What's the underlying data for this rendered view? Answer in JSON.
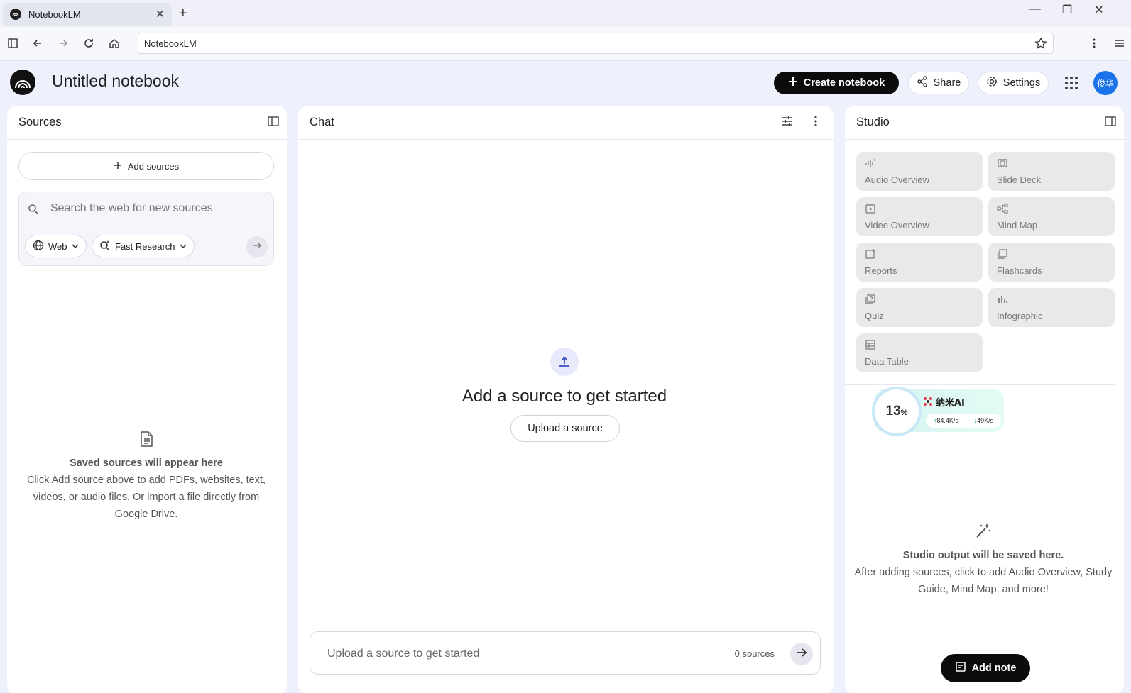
{
  "browser": {
    "tab_title": "NotebookLM",
    "url": "NotebookLM"
  },
  "header": {
    "notebook_title": "Untitled notebook",
    "create_label": "Create notebook",
    "share_label": "Share",
    "settings_label": "Settings",
    "avatar_text": "俊华"
  },
  "sources": {
    "title": "Sources",
    "add_label": "Add sources",
    "search_placeholder": "Search the web for new sources",
    "web_chip": "Web",
    "research_chip": "Fast Research",
    "empty_title": "Saved sources will appear here",
    "empty_body": "Click Add source above to add PDFs, websites, text, videos, or audio files. Or import a file directly from Google Drive."
  },
  "chat": {
    "title": "Chat",
    "heading": "Add a source to get started",
    "upload_label": "Upload a source",
    "input_placeholder": "Upload a source to get started",
    "source_count": "0 sources"
  },
  "studio": {
    "title": "Studio",
    "tiles": [
      {
        "label": "Audio Overview",
        "icon": "audio-waves-icon"
      },
      {
        "label": "Slide Deck",
        "icon": "slides-icon"
      },
      {
        "label": "Video Overview",
        "icon": "video-icon"
      },
      {
        "label": "Mind Map",
        "icon": "mind-map-icon"
      },
      {
        "label": "Reports",
        "icon": "reports-icon"
      },
      {
        "label": "Flashcards",
        "icon": "flashcards-icon"
      },
      {
        "label": "Quiz",
        "icon": "quiz-icon"
      },
      {
        "label": "Infographic",
        "icon": "infographic-icon"
      },
      {
        "label": "Data Table",
        "icon": "table-icon"
      }
    ],
    "empty_title": "Studio output will be saved here.",
    "empty_body": "After adding sources, click to add Audio Overview, Study Guide, Mind Map, and more!",
    "add_note_label": "Add note"
  },
  "speed_widget": {
    "percent": "13",
    "percent_sign": "%",
    "name": "纳米AI",
    "upload_rate": "84.4K/s",
    "download_rate": "49K/s"
  },
  "colors": {
    "page_bg": "#eef0fb",
    "primary_button": "#0b0b0b",
    "accent": "#1a73e8"
  }
}
